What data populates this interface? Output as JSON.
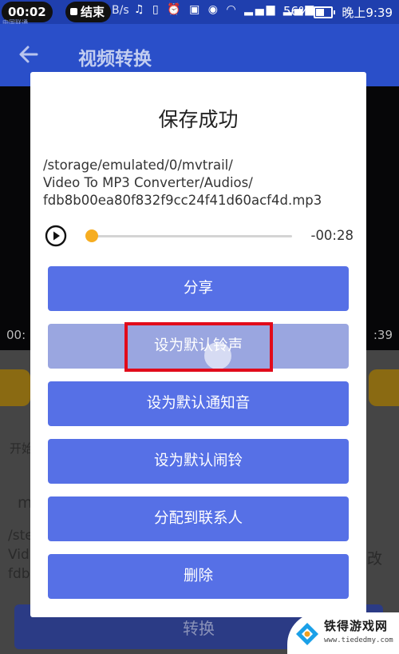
{
  "status_bar": {
    "time": "00:02",
    "recording_label": "结束",
    "net_speed": "B/s",
    "battery_percent": "56%",
    "clock": "晚上9:39",
    "carrier_line1": "中国联通",
    "carrier_line2": "中国移动",
    "icons": [
      "headset-icon",
      "vibrate-icon",
      "alarm-icon",
      "hd-icon",
      "eye-icon",
      "wifi-icon",
      "signal-4g-icon",
      "signal-icon",
      "battery-icon"
    ]
  },
  "app_bar": {
    "title": "视频转换"
  },
  "background": {
    "time_left": "00:",
    "time_right": ":39",
    "start_label": "开始",
    "field_prefix": "m",
    "path_prefix_1": "/ste",
    "path_prefix_2": "Vid",
    "path_prefix_3": "fdb",
    "right_char": "改",
    "convert_label": "转换"
  },
  "dialog": {
    "title": "保存成功",
    "path_lines": [
      "/storage/emulated/0/mvtrail/",
      "Video To MP3 Converter/Audios/",
      "fdb8b00ea80f832f9cc24f41d60acf4d.mp3"
    ],
    "player": {
      "remaining": "-00:28",
      "progress": 0.02
    },
    "buttons": {
      "share": "分享",
      "ringtone": "设为默认铃声",
      "notification": "设为默认通知音",
      "alarm": "设为默认闹铃",
      "contact": "分配到联系人",
      "delete": "删除"
    }
  },
  "colors": {
    "primary": "#2a4fc9",
    "dialog_button": "#5670e6",
    "highlight": "#e10b1b",
    "seek_thumb": "#f6ad21"
  },
  "watermark": {
    "name": "铁得游戏网",
    "url": "www.tiededmy.com"
  }
}
